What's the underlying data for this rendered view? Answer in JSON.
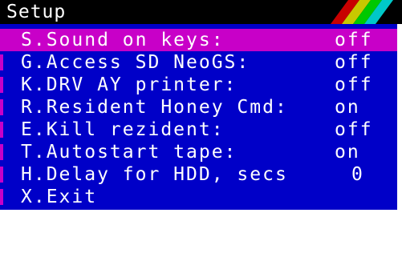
{
  "window": {
    "title": "Setup",
    "stripe_colors": [
      "#c80000",
      "#c8c800",
      "#00c800",
      "#00c8c8"
    ]
  },
  "menu": {
    "items": [
      {
        "label": "S.Sound on keys:",
        "value": "off",
        "selected": true
      },
      {
        "label": "G.Access SD NeoGS:",
        "value": "off",
        "selected": false
      },
      {
        "label": "K.DRV AY printer:",
        "value": "off",
        "selected": false
      },
      {
        "label": "R.Resident Honey Cmd:",
        "value": "on",
        "selected": false
      },
      {
        "label": "E.Kill rezident:",
        "value": "off",
        "selected": false
      },
      {
        "label": "T.Autostart tape:",
        "value": "on",
        "selected": false
      },
      {
        "label": "H.Delay for HDD, secs",
        "value": "0",
        "selected": false
      },
      {
        "label": "X.Exit",
        "value": "",
        "selected": false
      }
    ]
  },
  "colors": {
    "panel": "#0000c8",
    "highlight": "#c800c8",
    "text": "#ffffff"
  }
}
